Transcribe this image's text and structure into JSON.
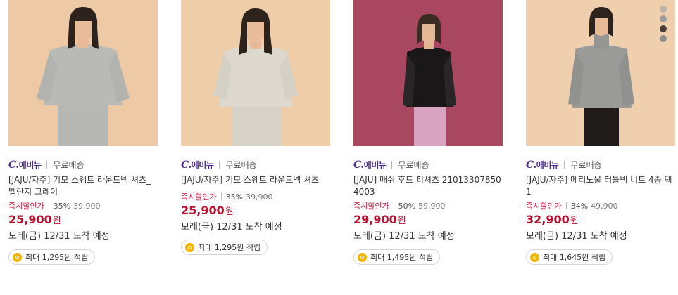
{
  "colors": {
    "brand": "#4b2a8c",
    "discount_label": "#d2163c",
    "price": "#b4122f",
    "coin": "#f4b400"
  },
  "products": [
    {
      "image_alt": "woman in gray crewneck sweatshirt",
      "brand_logo_prefix": "C.",
      "brand_logo": "에비뉴",
      "shipping": "무료배송",
      "title": "[JAJU/자주] 기모 스웨트 라운드넥 셔츠_멜란지 그레이",
      "discount_label": "즉시할인가",
      "discount_rate": "35%",
      "original_price": "39,900",
      "price": "25,900",
      "price_unit": "원",
      "delivery": "모레(금) 12/31 도착 예정",
      "points": "최대 1,295원 적립",
      "swatches": []
    },
    {
      "image_alt": "woman in light gray crewneck sweatshirt",
      "brand_logo_prefix": "C.",
      "brand_logo": "에비뉴",
      "shipping": "무료배송",
      "title": "[JAJU/자주] 기모 스웨트 라운드넥 셔츠",
      "discount_label": "즉시할인가",
      "discount_rate": "35%",
      "original_price": "39,900",
      "price": "25,900",
      "price_unit": "원",
      "delivery": "모레(금) 12/31 도착 예정",
      "points": "최대 1,295원 적립",
      "swatches": []
    },
    {
      "image_alt": "woman in black mesh hooded t-shirt",
      "brand_logo_prefix": "C.",
      "brand_logo": "에비뉴",
      "shipping": "무료배송",
      "title": "[JAJU] 매쉬 후드 티셔츠 210133078504003",
      "discount_label": "즉시할인가",
      "discount_rate": "50%",
      "original_price": "59,900",
      "price": "29,900",
      "price_unit": "원",
      "delivery": "모레(금) 12/31 도착 예정",
      "points": "최대 1,495원 적립",
      "swatches": []
    },
    {
      "image_alt": "woman in gray turtleneck knit",
      "brand_logo_prefix": "C.",
      "brand_logo": "에비뉴",
      "shipping": "무료배송",
      "title": "[JAJU/자주] 메리노울 터틀넥 니트 4종 택1",
      "discount_label": "즉시할인가",
      "discount_rate": "34%",
      "original_price": "49,900",
      "price": "32,900",
      "price_unit": "원",
      "delivery": "모레(금) 12/31 도착 예정",
      "points": "최대 1,645원 적립",
      "swatches": [
        "#bfb3a3",
        "#9c9c9c",
        "#4a3f38",
        "#8d8d8d"
      ]
    }
  ]
}
